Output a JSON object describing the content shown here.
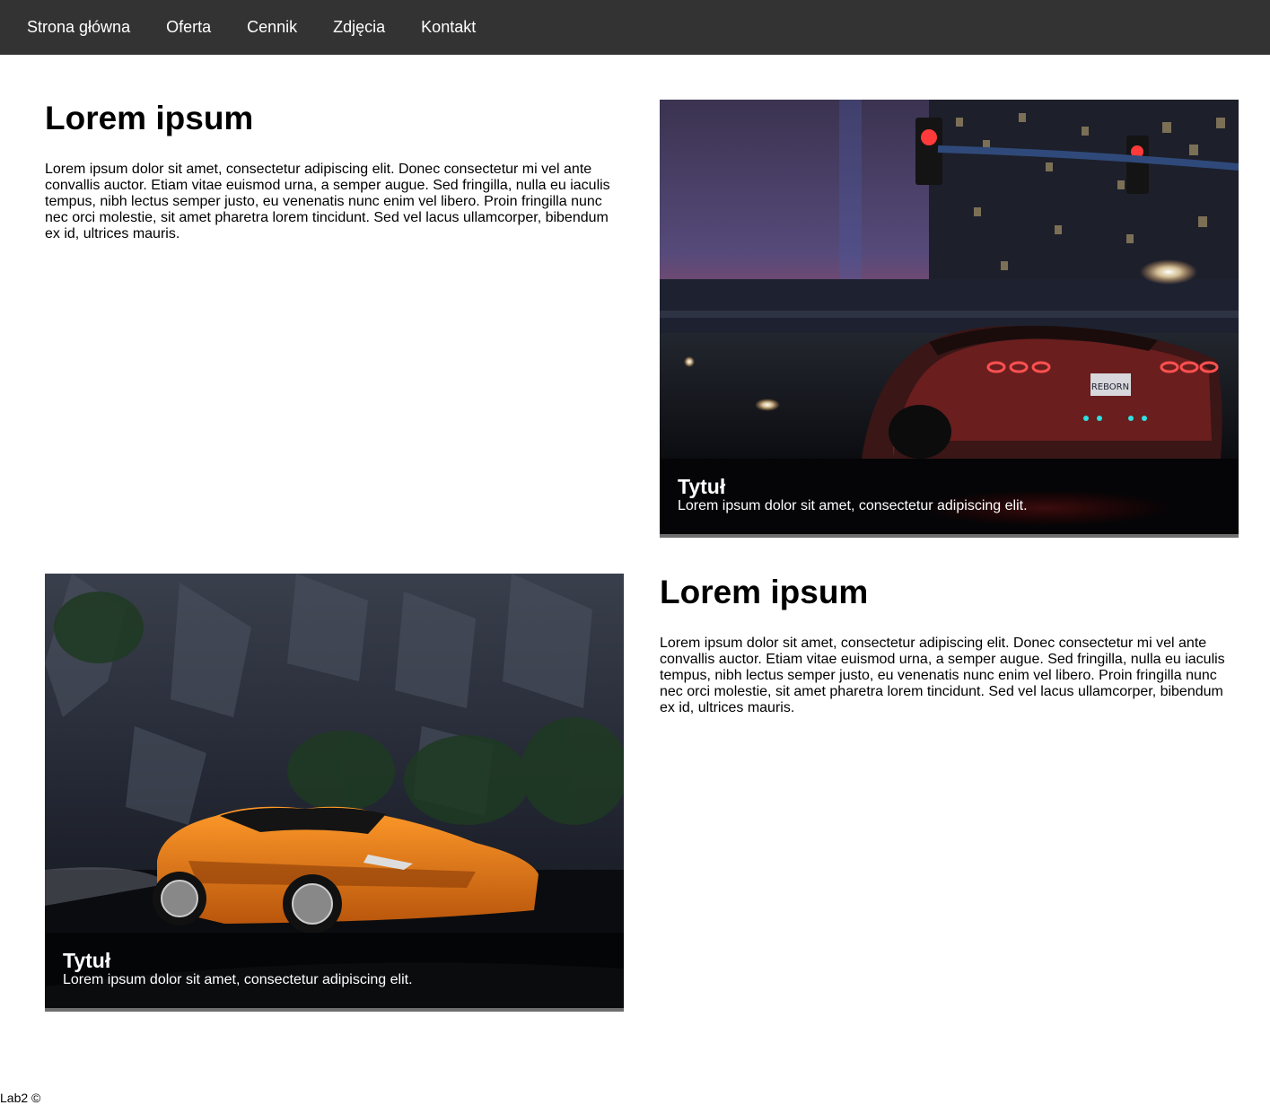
{
  "nav": {
    "items": [
      {
        "label": "Strona główna"
      },
      {
        "label": "Oferta"
      },
      {
        "label": "Cennik"
      },
      {
        "label": "Zdjęcia"
      },
      {
        "label": "Kontakt"
      }
    ]
  },
  "section1": {
    "heading": "Lorem ipsum",
    "text": "Lorem ipsum dolor sit amet, consectetur adipiscing elit. Donec consectetur mi vel ante convallis auctor. Etiam vitae euismod urna, a semper augue. Sed fringilla, nulla eu iaculis tempus, nibh lectus semper justo, eu venenatis nunc enim vel libero. Proin fringilla nunc nec orci molestie, sit amet pharetra lorem tincidunt. Sed vel lacus ullamcorper, bibendum ex id, ultrices mauris.",
    "image_caption": {
      "title": "Tytuł",
      "text": "Lorem ipsum dolor sit amet, consectetur adipiscing elit."
    },
    "plate_text": "REBORN"
  },
  "section2": {
    "heading": "Lorem ipsum",
    "text": "Lorem ipsum dolor sit amet, consectetur adipiscing elit. Donec consectetur mi vel ante convallis auctor. Etiam vitae euismod urna, a semper augue. Sed fringilla, nulla eu iaculis tempus, nibh lectus semper justo, eu venenatis nunc enim vel libero. Proin fringilla nunc nec orci molestie, sit amet pharetra lorem tincidunt. Sed vel lacus ullamcorper, bibendum ex id, ultrices mauris.",
    "image_caption": {
      "title": "Tytuł",
      "text": "Lorem ipsum dolor sit amet, consectetur adipiscing elit."
    }
  },
  "footer": {
    "text": "Lab2 ©"
  },
  "colors": {
    "navbar": "#333333",
    "nav_text": "#ffffff",
    "caption_bg": "rgba(0,0,0,0.55)"
  }
}
